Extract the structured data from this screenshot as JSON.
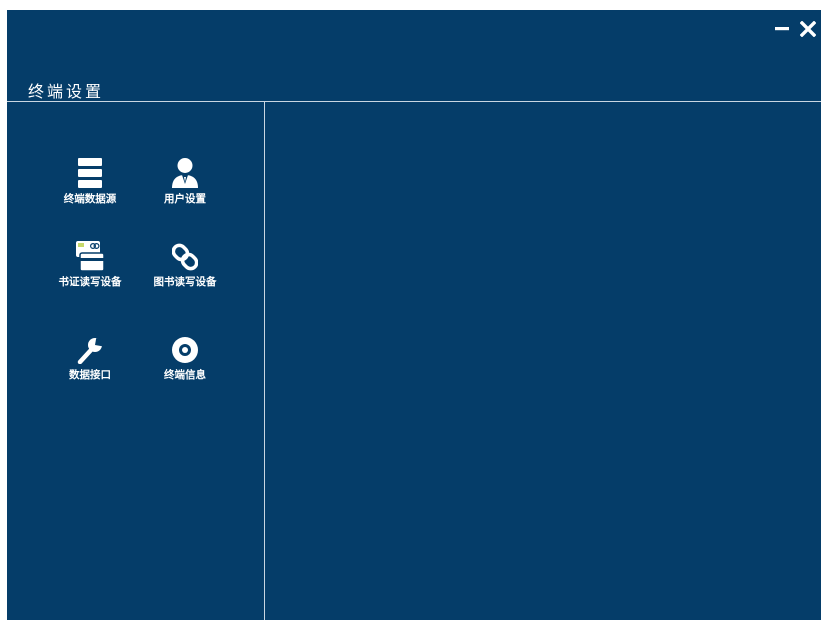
{
  "window": {
    "title": "终端设置",
    "background_color": "#053d69"
  },
  "controls": {
    "minimize_icon": "minus-icon",
    "close_icon": "close-icon"
  },
  "menu": {
    "items": [
      {
        "label": "终端数据源",
        "icon": "server-stack-icon"
      },
      {
        "label": "用户设置",
        "icon": "user-icon"
      },
      {
        "label": "书证读写设备",
        "icon": "card-reader-icon"
      },
      {
        "label": "图书读写设备",
        "icon": "link-icon"
      },
      {
        "label": "数据接口",
        "icon": "wrench-icon"
      },
      {
        "label": "终端信息",
        "icon": "disc-icon"
      }
    ]
  }
}
